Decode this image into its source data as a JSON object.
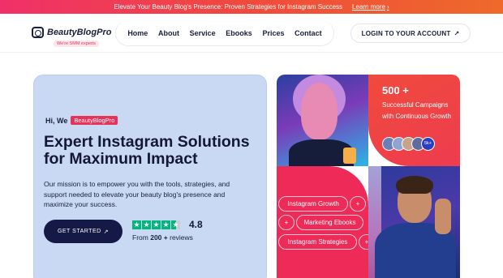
{
  "topbar": {
    "message": "Elevate Your Beauty Blog's Presence: Proven Strategies for Instagram Success",
    "link": "Learn more"
  },
  "header": {
    "logo_text": "BeautyBlogPro",
    "logo_tag": "We're SMM experts",
    "nav": [
      "Home",
      "About",
      "Service",
      "Ebooks",
      "Prices",
      "Contact"
    ],
    "login": "LOGIN TO YOUR ACCOUNT"
  },
  "hero": {
    "hi": "Hi, We",
    "badge": "BeautyBlogPro",
    "title": "Expert Instagram Solutions for Maximum Impact",
    "description": "Our mission is to empower you with the tools, strategies, and support needed to elevate your beauty blog's presence and maximize your success.",
    "cta": "GET STARTED",
    "rating": "4.8",
    "rating_stars": 4.5,
    "reviews_prefix": "From",
    "reviews_count": "200 +",
    "reviews_suffix": "reviews"
  },
  "stats": {
    "number": "500 +",
    "text": "Successful Campaigns with Continuous Growth",
    "avatar_more": "5k+"
  },
  "services": {
    "items": [
      "Instagram Growth",
      "Marketing Ebooks",
      "Instagram Strategies"
    ],
    "plus": "+"
  },
  "colors": {
    "accent": "#e8325a",
    "navy": "#141a45",
    "hero_bg": "#c9d9f4",
    "trustpilot": "#00b67a"
  }
}
